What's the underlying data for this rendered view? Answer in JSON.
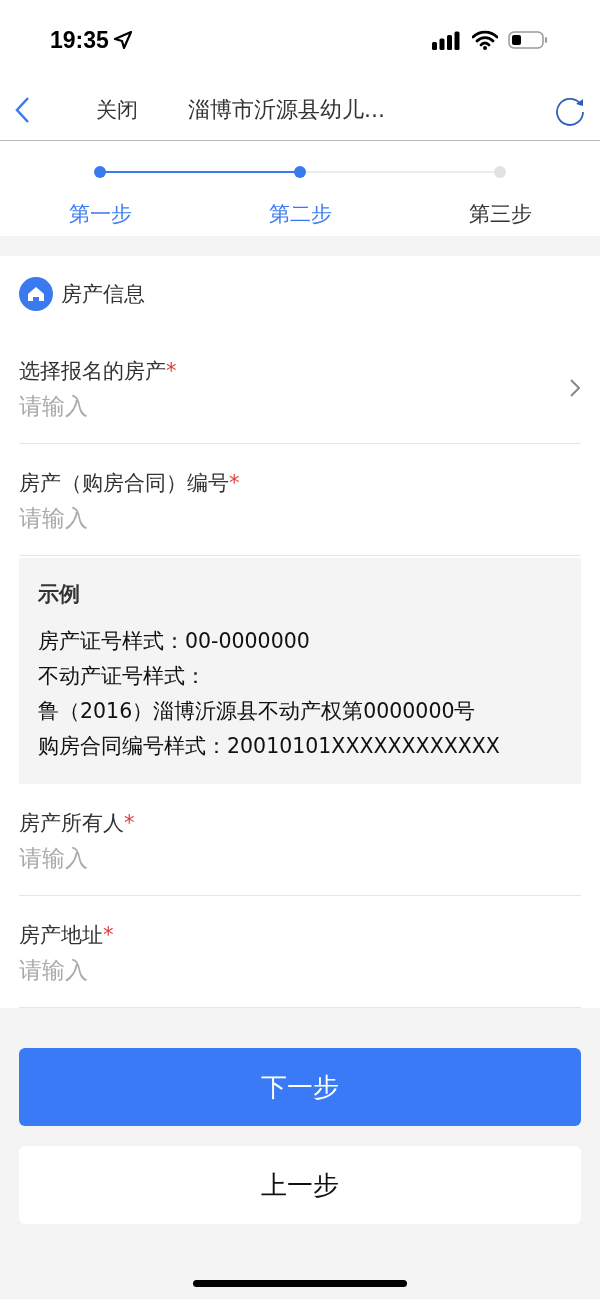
{
  "status_bar": {
    "time": "19:35"
  },
  "nav": {
    "close": "关闭",
    "title": "淄博市沂源县幼儿..."
  },
  "steps": [
    {
      "label": "第一步",
      "done": true
    },
    {
      "label": "第二步",
      "done": true
    },
    {
      "label": "第三步",
      "done": false
    }
  ],
  "section": {
    "title": "房产信息"
  },
  "fields": [
    {
      "kind": "select",
      "label": "选择报名的房产",
      "required_mark": "*",
      "placeholder": "请输入"
    },
    {
      "kind": "input",
      "label": "房产（购房合同）编号",
      "required_mark": "*",
      "placeholder": "请输入"
    },
    {
      "kind": "example",
      "title": "示例",
      "lines": [
        "房产证号样式：00-0000000",
        "不动产证号样式：",
        "鲁（2016）淄博沂源县不动产权第0000000号",
        "购房合同编号样式：20010101XXXXXXXXXXXX"
      ]
    },
    {
      "kind": "input",
      "label": "房产所有人",
      "required_mark": "*",
      "placeholder": "请输入"
    },
    {
      "kind": "input",
      "label": "房产地址",
      "required_mark": "*",
      "placeholder": "请输入"
    }
  ],
  "buttons": [
    {
      "label": "下一步",
      "primary": true
    },
    {
      "label": "上一步",
      "primary": false
    }
  ]
}
